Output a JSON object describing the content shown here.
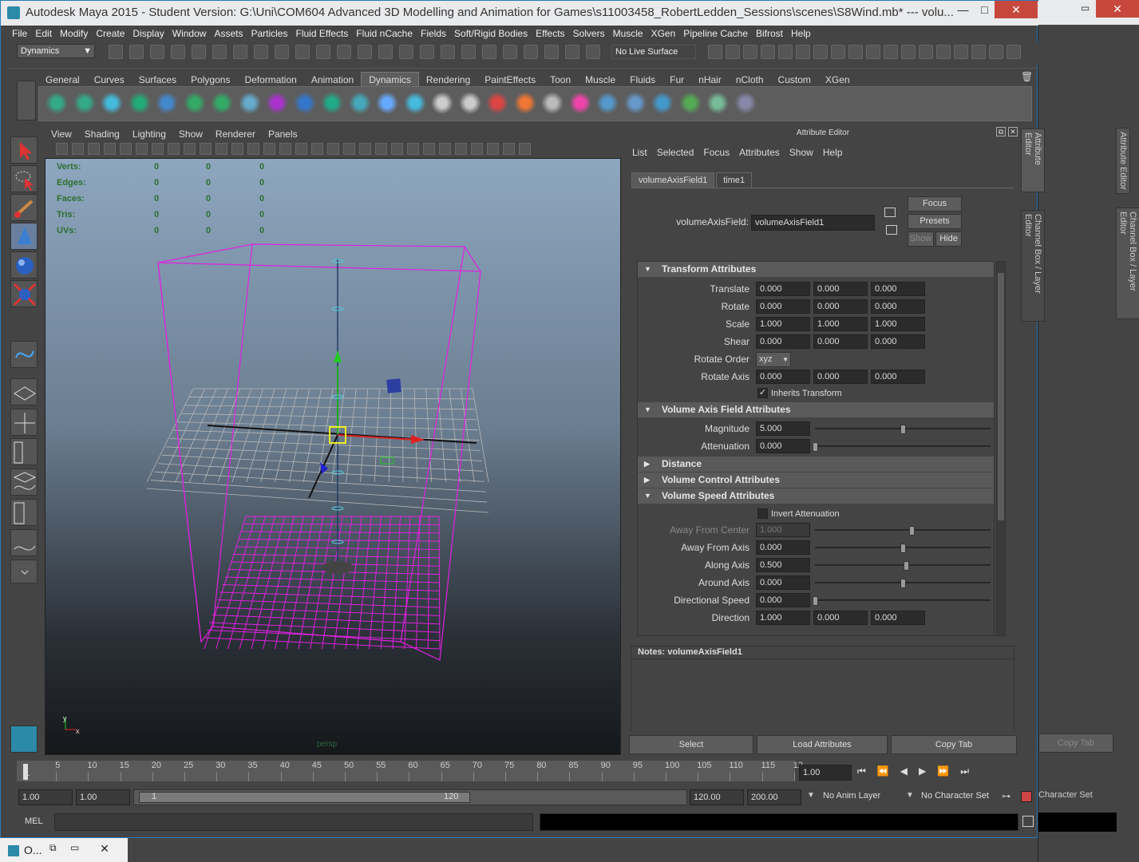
{
  "window": {
    "title": "Autodesk Maya 2015 - Student Version: G:\\Uni\\COM604 Advanced 3D Modelling and Animation for Games\\s11003458_RobertLedden_Sessions\\scenes\\S8Wind.mb*  ---   volu...",
    "min": "—",
    "max": "□",
    "close": "✕"
  },
  "menubar": [
    "File",
    "Edit",
    "Modify",
    "Create",
    "Display",
    "Window",
    "Assets",
    "Particles",
    "Fluid Effects",
    "Fluid nCache",
    "Fields",
    "Soft/Rigid Bodies",
    "Effects",
    "Solvers",
    "Muscle",
    "XGen",
    "Pipeline Cache",
    "Bifrost",
    "Help"
  ],
  "statusline": {
    "menuset": "Dynamics",
    "live_surface": "No Live Surface"
  },
  "shelf": {
    "tabs": [
      "General",
      "Curves",
      "Surfaces",
      "Polygons",
      "Deformation",
      "Animation",
      "Dynamics",
      "Rendering",
      "PaintEffects",
      "Toon",
      "Muscle",
      "Fluids",
      "Fur",
      "nHair",
      "nCloth",
      "Custom",
      "XGen"
    ],
    "active": "Dynamics"
  },
  "viewport": {
    "menu": [
      "View",
      "Shading",
      "Lighting",
      "Show",
      "Renderer",
      "Panels"
    ],
    "hud": [
      {
        "label": "Verts:",
        "values": [
          "0",
          "0",
          "0"
        ]
      },
      {
        "label": "Edges:",
        "values": [
          "0",
          "0",
          "0"
        ]
      },
      {
        "label": "Faces:",
        "values": [
          "0",
          "0",
          "0"
        ]
      },
      {
        "label": "Tris:",
        "values": [
          "0",
          "0",
          "0"
        ]
      },
      {
        "label": "UVs:",
        "values": [
          "0",
          "0",
          "0"
        ]
      }
    ],
    "camera": "persp",
    "axis_y": "y",
    "axis_x": "x"
  },
  "attribute_editor": {
    "title": "Attribute Editor",
    "menu": [
      "List",
      "Selected",
      "Focus",
      "Attributes",
      "Show",
      "Help"
    ],
    "tabs": [
      "volumeAxisField1",
      "time1"
    ],
    "node_label": "volumeAxisField:",
    "node_name": "volumeAxisField1",
    "buttons": {
      "focus": "Focus",
      "presets": "Presets",
      "show": "Show",
      "hide": "Hide"
    },
    "sections": {
      "transform": "Transform Attributes",
      "vaf": "Volume Axis Field Attributes",
      "distance": "Distance",
      "volctrl": "Volume Control Attributes",
      "volspeed": "Volume Speed Attributes"
    },
    "transform": {
      "translate": {
        "label": "Translate",
        "v": [
          "0.000",
          "0.000",
          "0.000"
        ]
      },
      "rotate": {
        "label": "Rotate",
        "v": [
          "0.000",
          "0.000",
          "0.000"
        ]
      },
      "scale": {
        "label": "Scale",
        "v": [
          "1.000",
          "1.000",
          "1.000"
        ]
      },
      "shear": {
        "label": "Shear",
        "v": [
          "0.000",
          "0.000",
          "0.000"
        ]
      },
      "rotate_order": {
        "label": "Rotate Order",
        "value": "xyz"
      },
      "rotate_axis": {
        "label": "Rotate Axis",
        "v": [
          "0.000",
          "0.000",
          "0.000"
        ]
      },
      "inherits": "Inherits Transform"
    },
    "vaf": {
      "magnitude": {
        "label": "Magnitude",
        "value": "5.000",
        "slider": 0.5
      },
      "attenuation": {
        "label": "Attenuation",
        "value": "0.000",
        "slider": 0.0
      }
    },
    "speed": {
      "invert": "Invert Attenuation",
      "away_center": {
        "label": "Away From Center",
        "value": "1.000",
        "slider": 0.55
      },
      "away_axis": {
        "label": "Away From Axis",
        "value": "0.000",
        "slider": 0.5
      },
      "along_axis": {
        "label": "Along Axis",
        "value": "0.500",
        "slider": 0.52
      },
      "around_axis": {
        "label": "Around Axis",
        "value": "0.000",
        "slider": 0.5
      },
      "dir_speed": {
        "label": "Directional Speed",
        "value": "0.000",
        "slider": 0.0
      },
      "direction": {
        "label": "Direction",
        "v": [
          "1.000",
          "0.000",
          "0.000"
        ]
      }
    },
    "notes_label": "Notes:  volumeAxisField1",
    "bottom": [
      "Select",
      "Load Attributes",
      "Copy Tab"
    ],
    "side_tabs": [
      "Attribute Editor",
      "Channel Box / Layer Editor"
    ]
  },
  "timeline": {
    "ticks": [
      "1",
      "5",
      "10",
      "15",
      "20",
      "25",
      "30",
      "35",
      "40",
      "45",
      "50",
      "55",
      "60",
      "65",
      "70",
      "75",
      "80",
      "85",
      "90",
      "95",
      "100",
      "105",
      "110",
      "115",
      "12"
    ],
    "current": "1.00"
  },
  "range": {
    "start": "1.00",
    "start2": "1.00",
    "rmin": "1",
    "rmax": "120",
    "end": "120.00",
    "end2": "200.00",
    "anim_layer": "No Anim Layer",
    "char_set": "No Character Set"
  },
  "cmd": {
    "label": "MEL"
  },
  "back_window": {
    "copy_tab": "Copy Tab",
    "char_set": "Character Set",
    "side": [
      "Attribute Editor",
      "Channel Box / Layer Editor"
    ]
  },
  "taskbar": {
    "label": "O..."
  }
}
